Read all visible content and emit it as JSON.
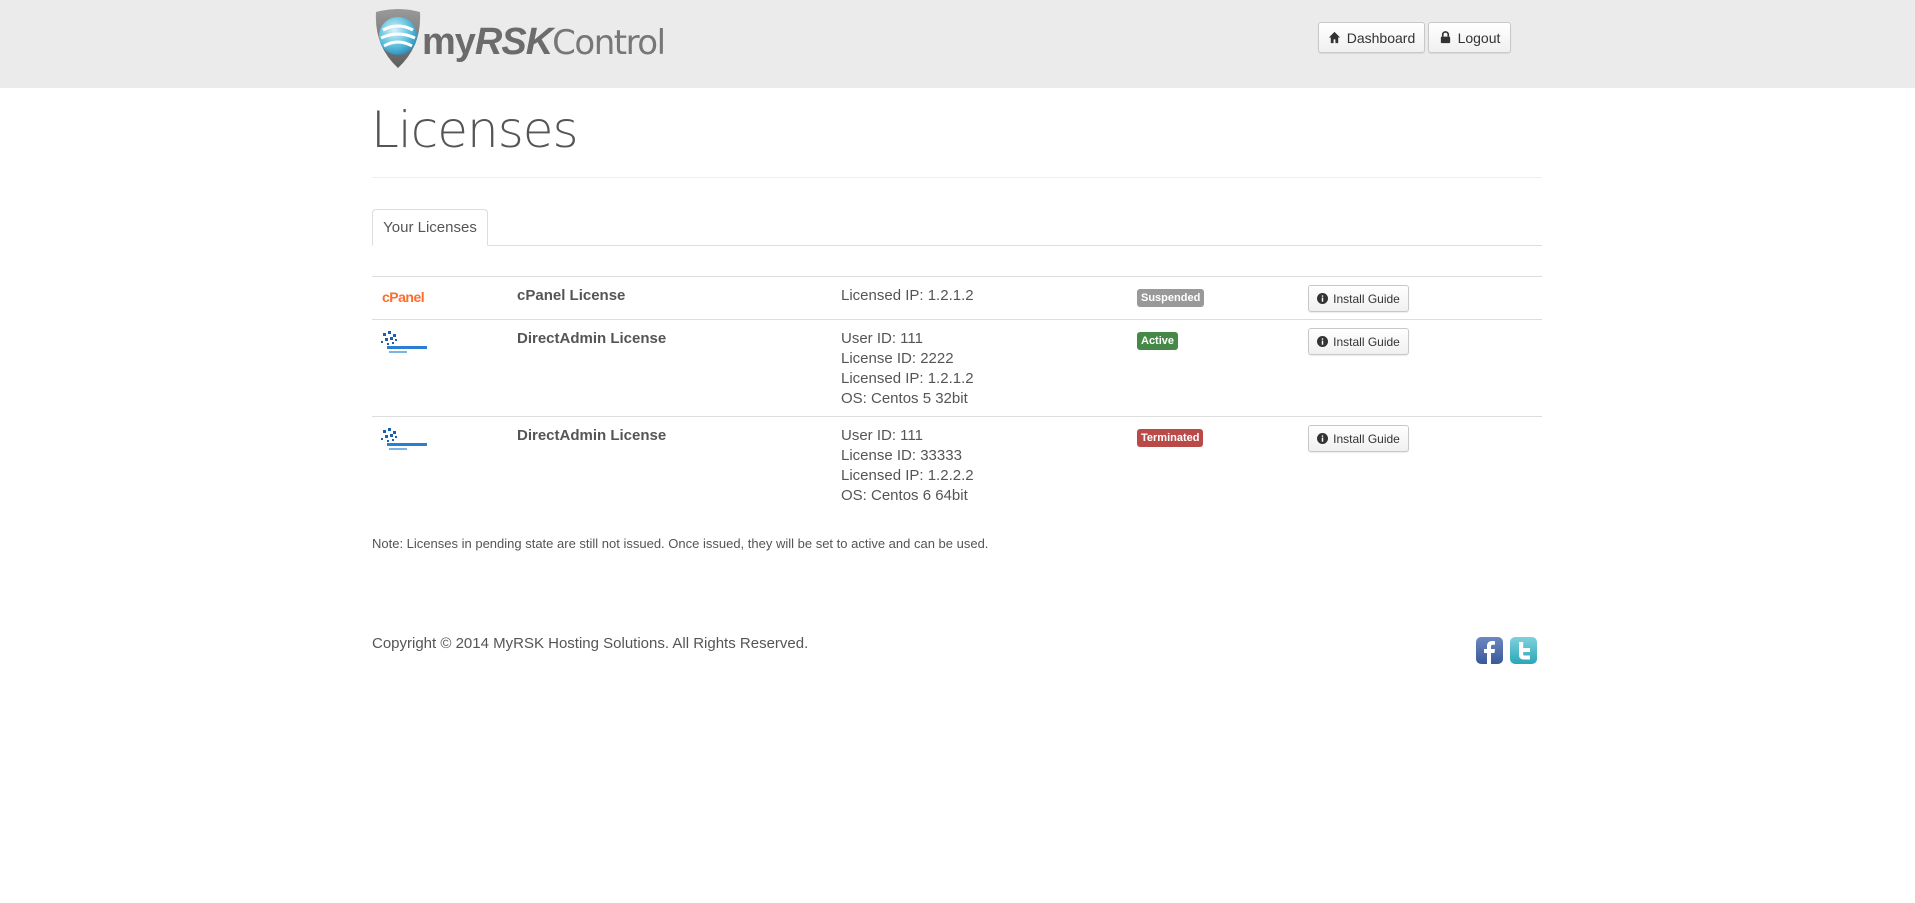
{
  "header": {
    "logo": {
      "my": "my",
      "rsk": "RSK",
      "control": "Control"
    },
    "buttons": {
      "dashboard": "Dashboard",
      "logout": "Logout"
    }
  },
  "page": {
    "title": "Licenses",
    "tab": "Your Licenses"
  },
  "licenses": [
    {
      "logo_text": "cPanel",
      "logo_icon": "cpanel-logo",
      "name": "cPanel License",
      "details": [
        "Licensed IP: 1.2.1.2"
      ],
      "status": "Suspended",
      "status_color": "#999999",
      "action": "Install Guide"
    },
    {
      "logo_icon": "directadmin-logo",
      "name": "DirectAdmin License",
      "details": [
        "User ID: 111",
        "License ID: 2222",
        "Licensed IP: 1.2.1.2",
        "OS: Centos 5 32bit"
      ],
      "status": "Active",
      "status_color": "#468847",
      "action": "Install Guide"
    },
    {
      "logo_icon": "directadmin-logo",
      "name": "DirectAdmin License",
      "details": [
        "User ID: 111",
        "License ID: 33333",
        "Licensed IP: 1.2.2.2",
        "OS: Centos 6 64bit"
      ],
      "status": "Terminated",
      "status_color": "#b94a48",
      "action": "Install Guide"
    }
  ],
  "note": "Note: Licenses in pending state are still not issued. Once issued, they will be set to active and can be used.",
  "footer": {
    "copyright": "Copyright © 2014 MyRSK Hosting Solutions. All Rights Reserved.",
    "social": [
      "facebook-icon",
      "twitter-icon"
    ]
  }
}
